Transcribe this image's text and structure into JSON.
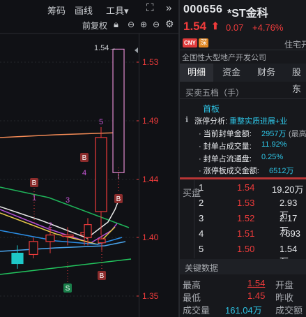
{
  "toolbar": {
    "chips": "筹码",
    "draw": "画线",
    "tools": "工具▾",
    "adjust": "前复权",
    "expand_icon": "expand-icon",
    "collapse_icon": "double-chevron-right-icon"
  },
  "chart_data": {
    "type": "candlestick",
    "y_ticks": [
      "1.53",
      "1.49",
      "1.44",
      "1.40",
      "1.35"
    ],
    "top_label": "1.54→",
    "candles": [
      {
        "o": 1.375,
        "c": 1.383,
        "h": 1.389,
        "l": 1.371,
        "color": "green"
      },
      {
        "o": 1.382,
        "c": 1.392,
        "h": 1.395,
        "l": 1.379,
        "color": "red"
      },
      {
        "o": 1.392,
        "c": 1.397,
        "h": 1.403,
        "l": 1.383,
        "color": "red"
      },
      {
        "o": 1.397,
        "c": 1.396,
        "h": 1.403,
        "l": 1.389,
        "color": "red"
      },
      {
        "o": 1.399,
        "c": 1.397,
        "h": 1.403,
        "l": 1.389,
        "color": "red"
      },
      {
        "o": 1.395,
        "c": 1.405,
        "h": 1.41,
        "l": 1.389,
        "color": "red"
      },
      {
        "o": 1.391,
        "c": 1.394,
        "h": 1.397,
        "l": 1.385,
        "color": "red"
      },
      {
        "o": 1.415,
        "c": 1.472,
        "h": 1.48,
        "l": 1.397,
        "color": "red"
      },
      {
        "o": 1.445,
        "c": 1.54,
        "h": 1.54,
        "l": 1.44,
        "color": "pink"
      }
    ],
    "signals": [
      {
        "text": "B",
        "kind": "buy"
      },
      {
        "text": "1",
        "kind": "count"
      },
      {
        "text": "2",
        "kind": "count"
      },
      {
        "text": "3",
        "kind": "count"
      },
      {
        "text": "4",
        "kind": "count"
      },
      {
        "text": "B",
        "kind": "buy"
      },
      {
        "text": "S",
        "kind": "sell"
      },
      {
        "text": "B",
        "kind": "buy"
      },
      {
        "text": "B",
        "kind": "buy"
      },
      {
        "text": "5",
        "kind": "count"
      }
    ]
  },
  "stock": {
    "code": "000656",
    "name": "*ST金科",
    "price": "1.54",
    "change": "0.07",
    "change_pct": "+4.76%",
    "badge_cny": "CNY",
    "badge_sz": "深",
    "sector": "住宅开",
    "industry": "全国性大型地产开发公司"
  },
  "tabs": [
    "明细",
    "资金",
    "财务",
    "股东"
  ],
  "order_book": {
    "title": "买卖五档（手）",
    "first_board": "首板",
    "limit_analysis_label": "涨停分析:",
    "limit_analysis_value": "重整实质进展+业",
    "items": [
      {
        "label": "· 当前封单金额:",
        "value": "2957万",
        "note": "(最高"
      },
      {
        "label": "· 封单占成交量:",
        "value": "11.92%"
      },
      {
        "label": "· 封单占流通盘:",
        "value": "0.25%"
      },
      {
        "label": "· 涨停板成交金额:",
        "value": "6512万"
      }
    ],
    "buy_label": "买盘",
    "bids": [
      {
        "level": "1",
        "price": "1.54",
        "volume": "19.20万"
      },
      {
        "level": "2",
        "price": "1.53",
        "volume": "2.93万"
      },
      {
        "level": "3",
        "price": "1.52",
        "volume": "2.17万"
      },
      {
        "level": "4",
        "price": "1.51",
        "volume": "7693"
      },
      {
        "level": "5",
        "price": "1.50",
        "volume": "1.54万"
      }
    ]
  },
  "key_data": {
    "title": "关键数据",
    "rows": [
      {
        "label": "最高",
        "value": "1.54",
        "label2": "开盘"
      },
      {
        "label": "最低",
        "value": "1.45",
        "label2": "昨收"
      },
      {
        "label": "成交量",
        "value": "161.04万",
        "label2": "成交额"
      }
    ]
  }
}
